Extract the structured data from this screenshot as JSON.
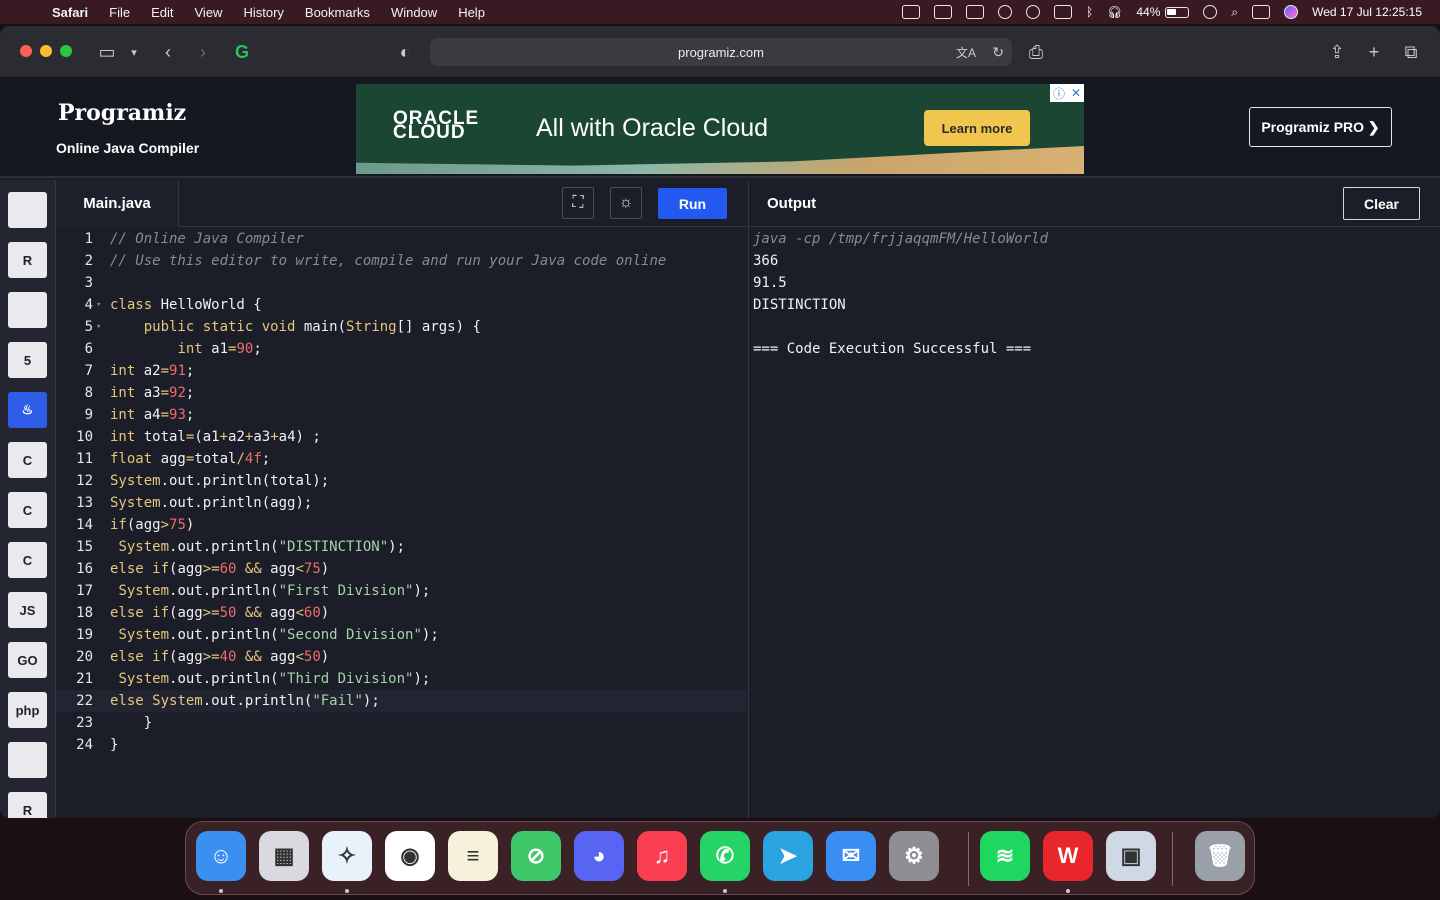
{
  "menubar": {
    "app": "Safari",
    "items": [
      "File",
      "Edit",
      "View",
      "History",
      "Bookmarks",
      "Window",
      "Help"
    ],
    "battery": "44%",
    "battery_level": 0.44,
    "clock": "Wed 17 Jul  12:25:15"
  },
  "browser": {
    "url": "programiz.com"
  },
  "header": {
    "logo": "Programiz",
    "subtitle": "Online Java Compiler",
    "pro_button": "Programiz PRO ❯"
  },
  "ad": {
    "brand_line1": "ORACLE",
    "brand_line2": "CLOUD",
    "headline": "All with Oracle Cloud",
    "cta": "Learn more"
  },
  "languages": [
    {
      "name": "python",
      "label": ""
    },
    {
      "name": "r",
      "label": "R"
    },
    {
      "name": "sql",
      "label": ""
    },
    {
      "name": "html",
      "label": "5"
    },
    {
      "name": "java",
      "label": "♨"
    },
    {
      "name": "c",
      "label": "C"
    },
    {
      "name": "cpp",
      "label": "C"
    },
    {
      "name": "csharp",
      "label": "C"
    },
    {
      "name": "js",
      "label": "JS"
    },
    {
      "name": "go",
      "label": "GO"
    },
    {
      "name": "php",
      "label": "php"
    },
    {
      "name": "swift",
      "label": ""
    },
    {
      "name": "rust",
      "label": "R"
    }
  ],
  "editor": {
    "filename": "Main.java",
    "run_label": "Run",
    "lines": [
      [
        [
          "cmt",
          "// Online Java Compiler"
        ]
      ],
      [
        [
          "cmt",
          "// Use this editor to write, compile and run your Java code online"
        ]
      ],
      [],
      [
        [
          "kw",
          "class "
        ],
        [
          "pl",
          "HelloWorld {"
        ]
      ],
      [
        [
          "pl",
          "    "
        ],
        [
          "kw",
          "public static void "
        ],
        [
          "pl",
          "main("
        ],
        [
          "kw",
          "String"
        ],
        [
          "pl",
          "[] args) {"
        ]
      ],
      [
        [
          "pl",
          "        "
        ],
        [
          "kw",
          "int "
        ],
        [
          "pl",
          "a1"
        ],
        [
          "kw",
          "="
        ],
        [
          "num",
          "90"
        ],
        [
          "pl",
          ";"
        ]
      ],
      [
        [
          "kw",
          "int "
        ],
        [
          "pl",
          "a2"
        ],
        [
          "kw",
          "="
        ],
        [
          "num",
          "91"
        ],
        [
          "pl",
          ";"
        ]
      ],
      [
        [
          "kw",
          "int "
        ],
        [
          "pl",
          "a3"
        ],
        [
          "kw",
          "="
        ],
        [
          "num",
          "92"
        ],
        [
          "pl",
          ";"
        ]
      ],
      [
        [
          "kw",
          "int "
        ],
        [
          "pl",
          "a4"
        ],
        [
          "kw",
          "="
        ],
        [
          "num",
          "93"
        ],
        [
          "pl",
          ";"
        ]
      ],
      [
        [
          "kw",
          "int "
        ],
        [
          "pl",
          "total"
        ],
        [
          "kw",
          "="
        ],
        [
          "pl",
          "(a1"
        ],
        [
          "kw",
          "+"
        ],
        [
          "pl",
          "a2"
        ],
        [
          "kw",
          "+"
        ],
        [
          "pl",
          "a3"
        ],
        [
          "kw",
          "+"
        ],
        [
          "pl",
          "a4) ;"
        ]
      ],
      [
        [
          "kw",
          "float "
        ],
        [
          "pl",
          "agg"
        ],
        [
          "kw",
          "="
        ],
        [
          "pl",
          "total"
        ],
        [
          "kw",
          "/"
        ],
        [
          "num",
          "4f"
        ],
        [
          "pl",
          ";"
        ]
      ],
      [
        [
          "kw",
          "System"
        ],
        [
          "pl",
          ".out.println(total);"
        ]
      ],
      [
        [
          "kw",
          "System"
        ],
        [
          "pl",
          ".out.println(agg);"
        ]
      ],
      [
        [
          "kw",
          "if"
        ],
        [
          "pl",
          "(agg"
        ],
        [
          "kw",
          ">"
        ],
        [
          "num",
          "75"
        ],
        [
          "pl",
          ")"
        ]
      ],
      [
        [
          "pl",
          " "
        ],
        [
          "kw",
          "System"
        ],
        [
          "pl",
          ".out.println("
        ],
        [
          "str",
          "\"DISTINCTION\""
        ],
        [
          "pl",
          ");"
        ]
      ],
      [
        [
          "kw",
          "else if"
        ],
        [
          "pl",
          "(agg"
        ],
        [
          "kw",
          ">="
        ],
        [
          "num",
          "60"
        ],
        [
          "pl",
          " "
        ],
        [
          "kw",
          "&&"
        ],
        [
          "pl",
          " agg"
        ],
        [
          "kw",
          "<"
        ],
        [
          "num",
          "75"
        ],
        [
          "pl",
          ")"
        ]
      ],
      [
        [
          "pl",
          " "
        ],
        [
          "kw",
          "System"
        ],
        [
          "pl",
          ".out.println("
        ],
        [
          "str",
          "\"First Division\""
        ],
        [
          "pl",
          ");"
        ]
      ],
      [
        [
          "kw",
          "else if"
        ],
        [
          "pl",
          "(agg"
        ],
        [
          "kw",
          ">="
        ],
        [
          "num",
          "50"
        ],
        [
          "pl",
          " "
        ],
        [
          "kw",
          "&&"
        ],
        [
          "pl",
          " agg"
        ],
        [
          "kw",
          "<"
        ],
        [
          "num",
          "60"
        ],
        [
          "pl",
          ")"
        ]
      ],
      [
        [
          "pl",
          " "
        ],
        [
          "kw",
          "System"
        ],
        [
          "pl",
          ".out.println("
        ],
        [
          "str",
          "\"Second Division\""
        ],
        [
          "pl",
          ");"
        ]
      ],
      [
        [
          "kw",
          "else if"
        ],
        [
          "pl",
          "(agg"
        ],
        [
          "kw",
          ">="
        ],
        [
          "num",
          "40"
        ],
        [
          "pl",
          " "
        ],
        [
          "kw",
          "&&"
        ],
        [
          "pl",
          " agg"
        ],
        [
          "kw",
          "<"
        ],
        [
          "num",
          "50"
        ],
        [
          "pl",
          ")"
        ]
      ],
      [
        [
          "pl",
          " "
        ],
        [
          "kw",
          "System"
        ],
        [
          "pl",
          ".out.println("
        ],
        [
          "str",
          "\"Third Division\""
        ],
        [
          "pl",
          ");"
        ]
      ],
      [
        [
          "kw",
          "else "
        ],
        [
          "kw",
          "System"
        ],
        [
          "pl",
          ".out.println("
        ],
        [
          "str",
          "\"Fail\""
        ],
        [
          "pl",
          ");"
        ]
      ],
      [
        [
          "pl",
          "    }"
        ]
      ],
      [
        [
          "pl",
          "}"
        ]
      ]
    ],
    "fold_lines": [
      4,
      5
    ],
    "highlight_line": 22
  },
  "output": {
    "title": "Output",
    "clear_label": "Clear",
    "command": "java -cp /tmp/frjjaqqmFM/HelloWorld",
    "lines": [
      "366",
      "91.5",
      "DISTINCTION",
      "",
      "=== Code Execution Successful ==="
    ]
  },
  "dock": [
    {
      "name": "finder",
      "color": "#3b8ff0",
      "glyph": "☺"
    },
    {
      "name": "launchpad",
      "color": "#d9d9df",
      "glyph": "▦"
    },
    {
      "name": "safari",
      "color": "#e9f2fb",
      "glyph": "✧"
    },
    {
      "name": "chrome",
      "color": "#ffffff",
      "glyph": "◉"
    },
    {
      "name": "notes",
      "color": "#f6f1da",
      "glyph": "≡"
    },
    {
      "name": "no-entry-app",
      "color": "#3ec86a",
      "glyph": "⊘"
    },
    {
      "name": "discord",
      "color": "#5865f2",
      "glyph": "◕"
    },
    {
      "name": "music",
      "color": "#fa3e51",
      "glyph": "♫"
    },
    {
      "name": "whatsapp",
      "color": "#25d366",
      "glyph": "✆"
    },
    {
      "name": "telegram",
      "color": "#2aa3e0",
      "glyph": "➤"
    },
    {
      "name": "mail",
      "color": "#3a8ef3",
      "glyph": "✉"
    },
    {
      "name": "system-settings",
      "color": "#8e8e93",
      "glyph": "⚙"
    },
    {
      "name": "spotify",
      "color": "#1ed760",
      "glyph": "≋"
    },
    {
      "name": "wps-office",
      "color": "#e8262b",
      "glyph": "W"
    },
    {
      "name": "preview",
      "color": "#cfd8e4",
      "glyph": "▣"
    },
    {
      "name": "trash",
      "color": "#9aa0a8",
      "glyph": "🗑"
    }
  ]
}
